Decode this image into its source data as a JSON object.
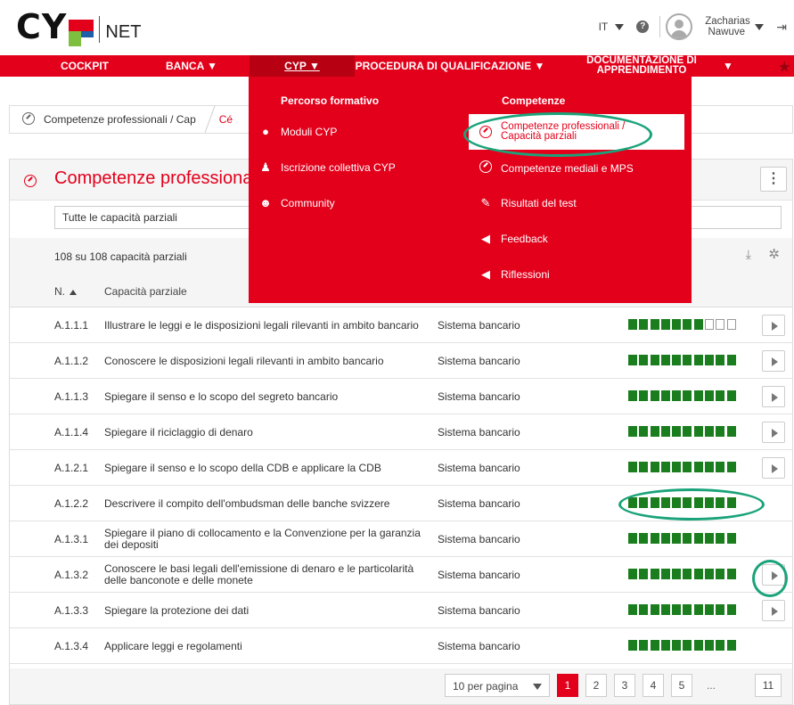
{
  "header": {
    "logo_text": "CY",
    "logo_net": "NET",
    "language": "IT",
    "help_glyph": "?",
    "user_first": "Zacharias",
    "user_last": "Nawuve"
  },
  "nav": {
    "items": [
      {
        "label": "COCKPIT"
      },
      {
        "label": "BANCA ▼"
      },
      {
        "label": "CYP ▼"
      },
      {
        "label": "PROCEDURA DI QUALIFICAZIONE ▼"
      },
      {
        "label_line1": "DOCUMENTAZIONE DI",
        "label_line2": "APPRENDIMENTO"
      },
      {
        "label": "▼"
      }
    ]
  },
  "dropdown": {
    "left_title": "Percorso formativo",
    "left_items": [
      {
        "label": "Moduli CYP",
        "icon": "modules-icon"
      },
      {
        "label": "Iscrizione collettiva CYP",
        "icon": "user-check-icon"
      },
      {
        "label": "Community",
        "icon": "community-icon"
      }
    ],
    "right_title": "Competenze",
    "right_items": [
      {
        "label_line1": "Competenze professionali /",
        "label_line2": "Capacità parziali",
        "icon": "compass-icon"
      },
      {
        "label": "Competenze mediali e MPS",
        "icon": "compass-icon"
      },
      {
        "label": "Risultati del test",
        "icon": "test-result-icon"
      },
      {
        "label": "Feedback",
        "icon": "megaphone-icon"
      },
      {
        "label": "Riflessioni",
        "icon": "megaphone-icon"
      }
    ]
  },
  "breadcrumb": {
    "item1": "Competenze professionali / Cap",
    "item2": "Cé"
  },
  "panel": {
    "title": "Competenze professionali",
    "filter_value": "Tutte le capacità parziali",
    "count_text": "108 su 108 capacità parziali",
    "col_number": "N.",
    "col_capacity": "Capacità parziale"
  },
  "rows": [
    {
      "num": "A.1.1.1",
      "cap": "Illustrare le leggi e le disposizioni legali rilevanti in ambito bancario",
      "area": "Sistema bancario",
      "filled": 7,
      "total": 10,
      "play": true
    },
    {
      "num": "A.1.1.2",
      "cap": "Conoscere le disposizioni legali rilevanti in ambito bancario",
      "area": "Sistema bancario",
      "filled": 10,
      "total": 10,
      "play": true
    },
    {
      "num": "A.1.1.3",
      "cap": "Spiegare il senso e lo scopo del segreto bancario",
      "area": "Sistema bancario",
      "filled": 10,
      "total": 10,
      "play": true
    },
    {
      "num": "A.1.1.4",
      "cap": "Spiegare il riciclaggio di denaro",
      "area": "Sistema bancario",
      "filled": 10,
      "total": 10,
      "play": true
    },
    {
      "num": "A.1.2.1",
      "cap": "Spiegare il senso e lo scopo della CDB e applicare la CDB",
      "area": "Sistema bancario",
      "filled": 10,
      "total": 10,
      "play": true
    },
    {
      "num": "A.1.2.2",
      "cap": "Descrivere il compito dell'ombudsman delle banche svizzere",
      "area": "Sistema bancario",
      "filled": 10,
      "total": 10,
      "play": false
    },
    {
      "num": "A.1.3.1",
      "cap": "Spiegare il piano di collocamento e la Convenzione per la garanzia dei depositi",
      "area": "Sistema bancario",
      "filled": 10,
      "total": 10,
      "play": false
    },
    {
      "num": "A.1.3.2",
      "cap": "Conoscere le basi legali dell'emissione di denaro e le particolarità delle banconote e delle monete",
      "area": "Sistema bancario",
      "filled": 10,
      "total": 10,
      "play": true
    },
    {
      "num": "A.1.3.3",
      "cap": "Spiegare la protezione dei dati",
      "area": "Sistema bancario",
      "filled": 10,
      "total": 10,
      "play": true
    },
    {
      "num": "A.1.3.4",
      "cap": "Applicare leggi e regolamenti",
      "area": "Sistema bancario",
      "filled": 10,
      "total": 10,
      "play": false
    }
  ],
  "pagination": {
    "per_page": "10 per pagina",
    "pages": [
      "1",
      "2",
      "3",
      "4",
      "5"
    ],
    "dots": "...",
    "last": "11",
    "current": "1"
  },
  "colors": {
    "brand_red": "#e3001b",
    "progress_green": "#1a7d1e",
    "annotation": "#1aa37a"
  }
}
